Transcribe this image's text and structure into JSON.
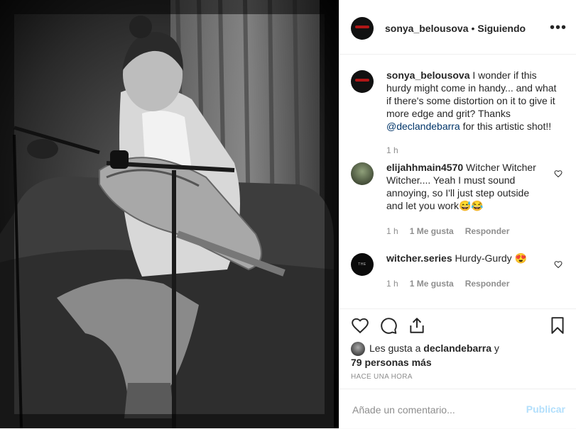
{
  "post": {
    "username": "sonya_belousova",
    "separator": "•",
    "follow_status": "Siguiendo",
    "more_label": "•••"
  },
  "caption": {
    "username": "sonya_belousova",
    "text_before": " I wonder if this hurdy might come in handy... and what if there's some distortion on it to give it more edge and grit? Thanks ",
    "mention": "@declandebarra",
    "text_after": " for this artistic shot!!",
    "time": "1 h"
  },
  "comments": [
    {
      "username": "elijahhmain4570",
      "text": " Witcher Witcher Witcher.... Yeah I must sound annoying, so I'll just step outside and let you work😅😂",
      "time": "1 h",
      "likes": "1 Me gusta",
      "reply": "Responder"
    },
    {
      "username": "witcher.series",
      "text": " Hurdy-Gurdy 😍",
      "time": "1 h",
      "likes": "1 Me gusta",
      "reply": "Responder",
      "avatar_text": "THE WITCHER"
    }
  ],
  "likes": {
    "prefix": "Les gusta a ",
    "user": "declandebarra",
    "middle": " y ",
    "count": "79 personas más"
  },
  "timestamp": "HACE UNA HORA",
  "comment_box": {
    "placeholder": "Añade un comentario...",
    "publish": "Publicar"
  },
  "colors": {
    "link": "#003569",
    "publish_disabled": "#b2dffc",
    "muted": "#8e8e8e"
  }
}
